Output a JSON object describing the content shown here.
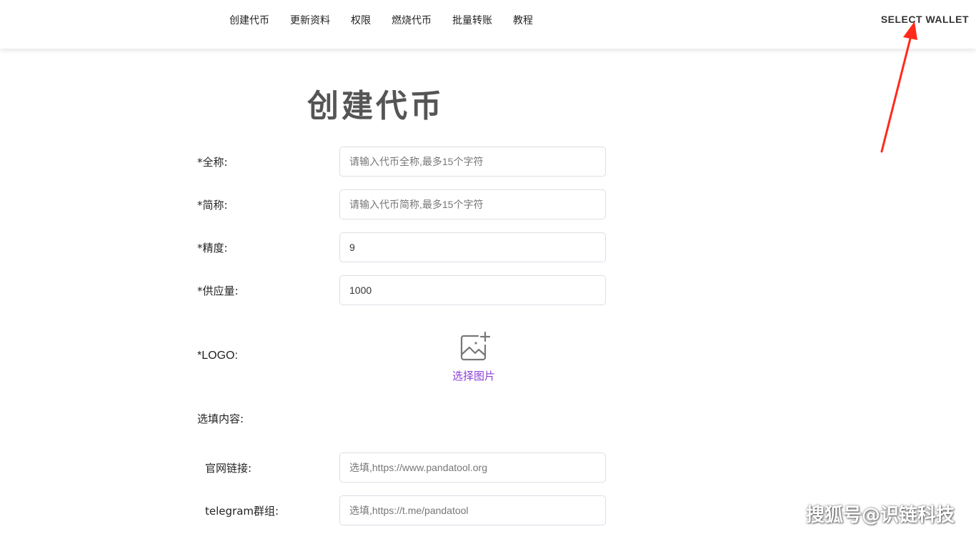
{
  "nav": {
    "items": [
      "创建代币",
      "更新资料",
      "权限",
      "燃烧代币",
      "批量转账",
      "教程"
    ],
    "wallet_button": "SELECT WALLET"
  },
  "page": {
    "title": "创建代币"
  },
  "form": {
    "full_name": {
      "label": "*全称:",
      "placeholder": "请输入代币全称,最多15个字符",
      "value": ""
    },
    "symbol": {
      "label": "*简称:",
      "placeholder": "请输入代币简称,最多15个字符",
      "value": ""
    },
    "decimals": {
      "label": "*精度:",
      "placeholder": "",
      "value": "9"
    },
    "supply": {
      "label": "*供应量:",
      "placeholder": "",
      "value": "1000"
    },
    "logo": {
      "label": "*LOGO:",
      "upload_text": "选择图片",
      "icon": "image-add-icon"
    },
    "optional_heading": "选填内容:",
    "website": {
      "label": "官网链接:",
      "placeholder": "选填,https://www.pandatool.org",
      "value": ""
    },
    "telegram": {
      "label": "telegram群组:",
      "placeholder": "选填,https://t.me/pandatool",
      "value": ""
    }
  },
  "annotation": {
    "icon": "red-arrow-icon",
    "color": "#ff2a1a"
  },
  "watermark": "搜狐号@识链科技",
  "colors": {
    "accent": "#8b3fd9",
    "input_border": "#dcdfe6"
  }
}
